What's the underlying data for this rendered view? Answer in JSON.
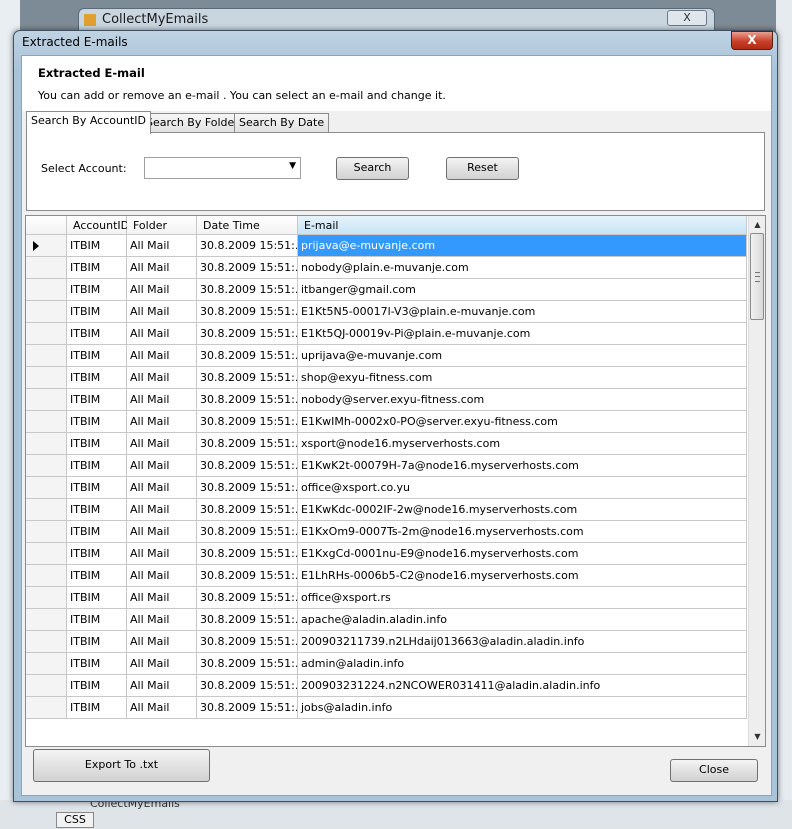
{
  "background_window": {
    "title": "CollectMyEmails",
    "close_label": "X",
    "bottom_label": "CollectMyEmails",
    "css_label": "CSS"
  },
  "dialog": {
    "title": "Extracted E-mails",
    "close_label": "X",
    "header": {
      "title": "Extracted E-mail",
      "description": "You can add or remove an e-mail . You can select an e-mail  and change it."
    },
    "tabs": [
      "Search By AccountID",
      "Search By Folder",
      "Search By Date"
    ],
    "search": {
      "select_label": "Select Account:",
      "select_value": "",
      "search_button": "Search",
      "reset_button": "Reset"
    },
    "grid": {
      "columns": [
        "AccountID",
        "Folder",
        "Date Time",
        "E-mail"
      ],
      "selected_row": 0,
      "rows": [
        [
          "ITBIM",
          "All Mail",
          "30.8.2009 15:51:...",
          "prijava@e-muvanje.com"
        ],
        [
          "ITBIM",
          "All Mail",
          "30.8.2009 15:51:...",
          "nobody@plain.e-muvanje.com"
        ],
        [
          "ITBIM",
          "All Mail",
          "30.8.2009 15:51:...",
          "itbanger@gmail.com"
        ],
        [
          "ITBIM",
          "All Mail",
          "30.8.2009 15:51:...",
          "E1Kt5N5-00017l-V3@plain.e-muvanje.com"
        ],
        [
          "ITBIM",
          "All Mail",
          "30.8.2009 15:51:...",
          "E1Kt5QJ-00019v-Pi@plain.e-muvanje.com"
        ],
        [
          "ITBIM",
          "All Mail",
          "30.8.2009 15:51:...",
          "uprijava@e-muvanje.com"
        ],
        [
          "ITBIM",
          "All Mail",
          "30.8.2009 15:51:...",
          "shop@exyu-fitness.com"
        ],
        [
          "ITBIM",
          "All Mail",
          "30.8.2009 15:51:...",
          "nobody@server.exyu-fitness.com"
        ],
        [
          "ITBIM",
          "All Mail",
          "30.8.2009 15:51:...",
          "E1KwIMh-0002x0-PO@server.exyu-fitness.com"
        ],
        [
          "ITBIM",
          "All Mail",
          "30.8.2009 15:51:...",
          "xsport@node16.myserverhosts.com"
        ],
        [
          "ITBIM",
          "All Mail",
          "30.8.2009 15:51:...",
          "E1KwK2t-00079H-7a@node16.myserverhosts.com"
        ],
        [
          "ITBIM",
          "All Mail",
          "30.8.2009 15:51:...",
          "office@xsport.co.yu"
        ],
        [
          "ITBIM",
          "All Mail",
          "30.8.2009 15:51:...",
          "E1KwKdc-0002IF-2w@node16.myserverhosts.com"
        ],
        [
          "ITBIM",
          "All Mail",
          "30.8.2009 15:51:...",
          "E1KxOm9-0007Ts-2m@node16.myserverhosts.com"
        ],
        [
          "ITBIM",
          "All Mail",
          "30.8.2009 15:51:...",
          "E1KxgCd-0001nu-E9@node16.myserverhosts.com"
        ],
        [
          "ITBIM",
          "All Mail",
          "30.8.2009 15:51:...",
          "E1LhRHs-0006b5-C2@node16.myserverhosts.com"
        ],
        [
          "ITBIM",
          "All Mail",
          "30.8.2009 15:51:...",
          "office@xsport.rs"
        ],
        [
          "ITBIM",
          "All Mail",
          "30.8.2009 15:51:...",
          "apache@aladin.aladin.info"
        ],
        [
          "ITBIM",
          "All Mail",
          "30.8.2009 15:51:...",
          "200903211739.n2LHdaij013663@aladin.aladin.info"
        ],
        [
          "ITBIM",
          "All Mail",
          "30.8.2009 15:51:...",
          "admin@aladin.info"
        ],
        [
          "ITBIM",
          "All Mail",
          "30.8.2009 15:51:...",
          "200903231224.n2NCOWER031411@aladin.aladin.info"
        ],
        [
          "ITBIM",
          "All Mail",
          "30.8.2009 15:51:...",
          "jobs@aladin.info"
        ]
      ]
    },
    "export_button": "Export To .txt",
    "close_button": "Close"
  },
  "colors": {
    "selection": "#3399ff",
    "title_bar": "#bfd3e3",
    "close_button": "#c8402a"
  },
  "icons": {
    "row_indicator": "triangle-right-icon",
    "scroll_up": "chevron-up-icon",
    "scroll_down": "chevron-down-icon",
    "select_arrow": "chevron-down-icon"
  }
}
